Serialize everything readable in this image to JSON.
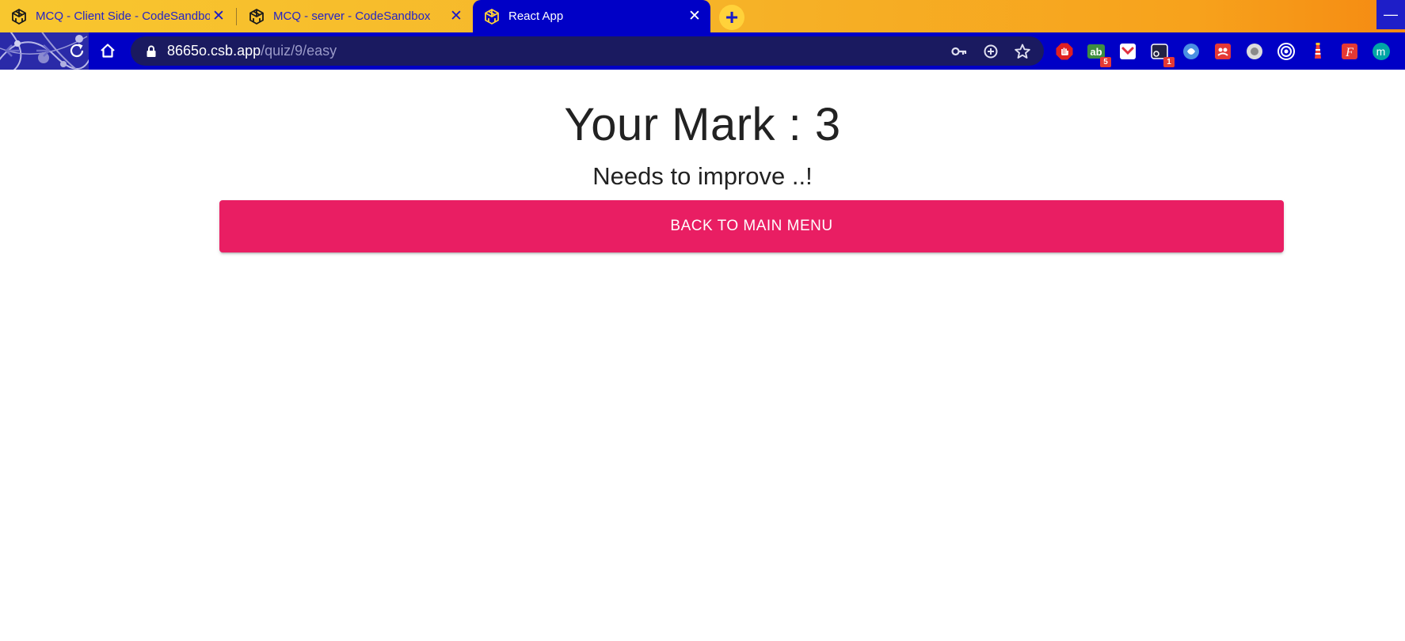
{
  "browser": {
    "tabs": [
      {
        "title": "MCQ - Client Side - CodeSandbox",
        "icon": "codesandbox-icon",
        "active": false
      },
      {
        "title": "MCQ - server - CodeSandbox",
        "icon": "codesandbox-icon",
        "active": false
      },
      {
        "title": "React App",
        "icon": "codesandbox-icon",
        "active": true
      }
    ],
    "close_glyph": "✕",
    "new_tab_glyph": "+",
    "minimize_glyph": "—",
    "url_host": "8665o.csb.app",
    "url_path": "/quiz/9/easy",
    "extension_badges": {
      "ext2": "5",
      "ext4": "1"
    },
    "extension_avatar_letter": "m"
  },
  "page": {
    "title": "Your Mark : 3",
    "subtitle": "Needs to improve ..!",
    "back_button": "BACK TO MAIN MENU"
  },
  "colors": {
    "tabstrip_gradient_start": "#f8c72f",
    "tabstrip_gradient_end": "#f58a12",
    "toolbar": "#0000c6",
    "omnibox": "#1a1a60",
    "button": "#e91e63"
  }
}
